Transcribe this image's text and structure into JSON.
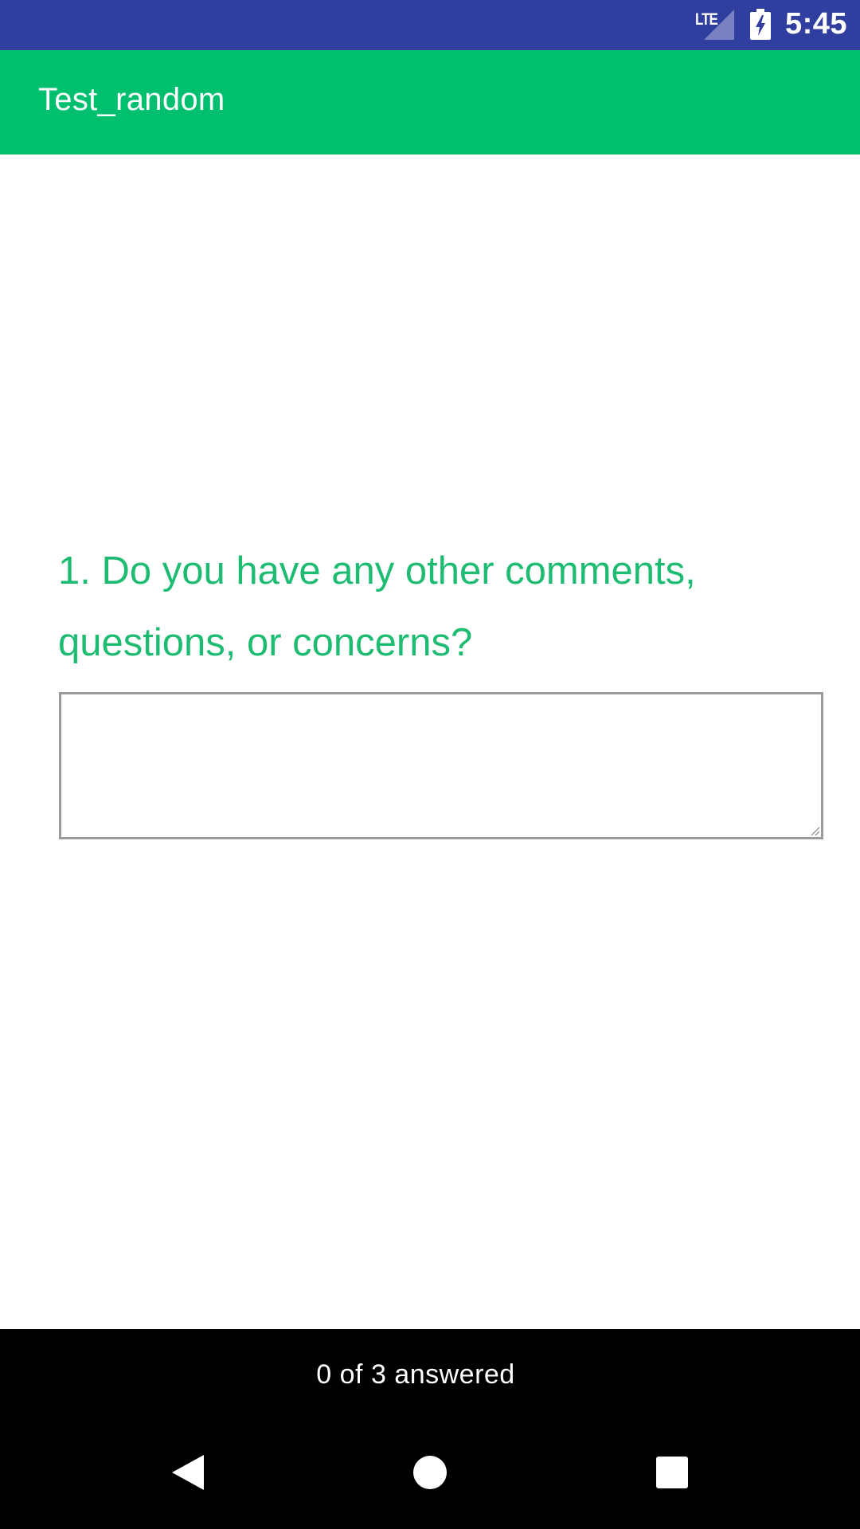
{
  "status_bar": {
    "network": "LTE",
    "time": "5:45",
    "signal_icon": "cell-signal-icon",
    "battery_icon": "battery-charging-icon",
    "color": "#303f9f"
  },
  "app_bar": {
    "title": "Test_random",
    "color": "#00bf6f"
  },
  "question": {
    "text": "1. Do you have any other comments, questions, or concerns?",
    "answer_value": "",
    "color": "#1ebc72"
  },
  "footer": {
    "progress": "0 of 3 answered"
  },
  "nav_bar": {
    "icons": [
      "back-triangle-icon",
      "home-circle-icon",
      "recents-square-icon"
    ]
  }
}
